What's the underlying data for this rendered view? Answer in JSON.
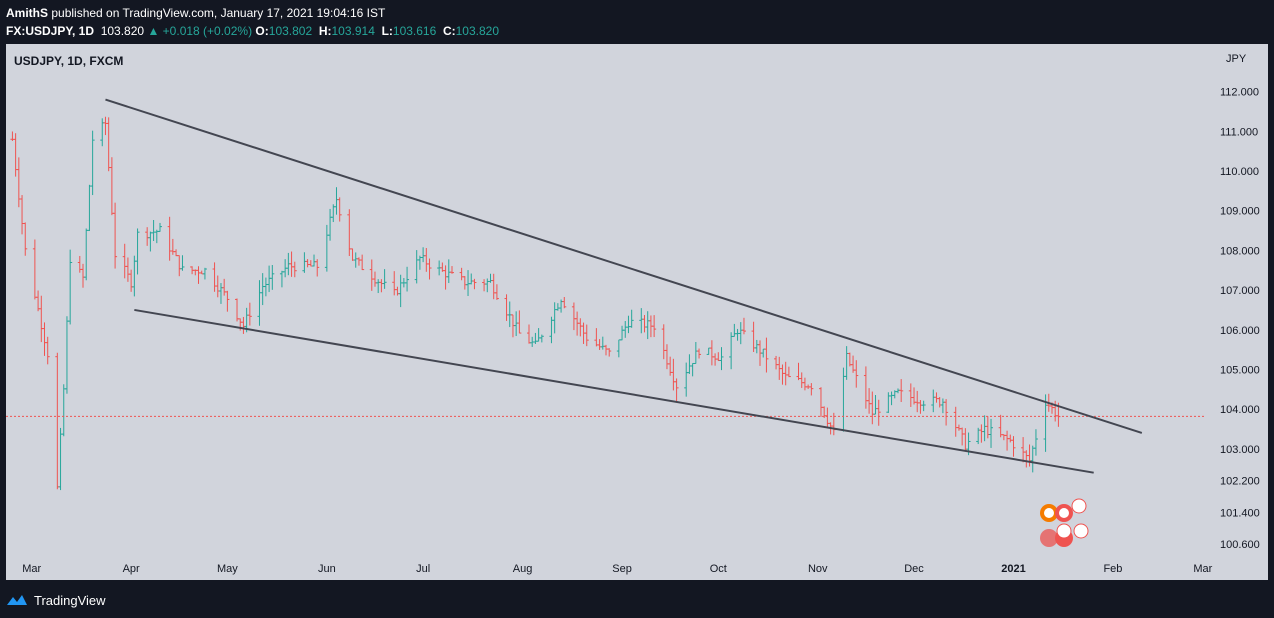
{
  "header": {
    "author": "AmithS",
    "published_text": "published on TradingView.com, January 17, 2021 19:04:16 IST",
    "symbol": "FX:USDJPY, 1D",
    "last": "103.820",
    "change_arrow": "▲",
    "change": "+0.018 (+0.02%)",
    "o_label": "O:",
    "o_value": "103.802",
    "h_label": "H:",
    "h_value": "103.914",
    "l_label": "L:",
    "l_value": "103.616",
    "c_label": "C:",
    "c_value": "103.820"
  },
  "chart_label": "USDJPY, 1D, FXCM",
  "currency": "JPY",
  "footer": {
    "brand": "TradingView"
  },
  "colors": {
    "background": "#d1d4dc",
    "up": "#26a69a",
    "down": "#ef5350",
    "trendline": "#434651",
    "price_line": "#ef5350"
  },
  "chart_data": {
    "type": "ohlc",
    "symbol": "USDJPY",
    "timeframe": "1D",
    "source": "FXCM",
    "y_ticks": [
      "112.000",
      "111.000",
      "110.000",
      "109.000",
      "108.000",
      "107.000",
      "106.000",
      "105.000",
      "104.000",
      "103.000",
      "102.200",
      "101.400",
      "100.600"
    ],
    "x_ticks": [
      "Mar",
      "Apr",
      "May",
      "Jun",
      "Jul",
      "Aug",
      "Sep",
      "Oct",
      "Nov",
      "Dec",
      "2021",
      "Feb",
      "Mar"
    ],
    "ylim": [
      100.2,
      113.2
    ],
    "last_price": 103.82,
    "close_path": [
      [
        "2020-02-24",
        110.8
      ],
      [
        "2020-02-28",
        108.0
      ],
      [
        "2020-03-06",
        105.4
      ],
      [
        "2020-03-09",
        102.0
      ],
      [
        "2020-03-11",
        104.5
      ],
      [
        "2020-03-13",
        107.8
      ],
      [
        "2020-03-17",
        107.3
      ],
      [
        "2020-03-20",
        110.8
      ],
      [
        "2020-03-24",
        111.2
      ],
      [
        "2020-03-27",
        107.9
      ],
      [
        "2020-04-01",
        107.2
      ],
      [
        "2020-04-03",
        108.4
      ],
      [
        "2020-04-10",
        108.5
      ],
      [
        "2020-04-17",
        107.5
      ],
      [
        "2020-04-24",
        107.5
      ],
      [
        "2020-05-01",
        106.8
      ],
      [
        "2020-05-06",
        106.1
      ],
      [
        "2020-05-12",
        107.1
      ],
      [
        "2020-05-20",
        107.6
      ],
      [
        "2020-05-29",
        107.6
      ],
      [
        "2020-06-04",
        109.3
      ],
      [
        "2020-06-09",
        107.8
      ],
      [
        "2020-06-16",
        107.3
      ],
      [
        "2020-06-22",
        106.9
      ],
      [
        "2020-06-30",
        107.8
      ],
      [
        "2020-07-06",
        107.5
      ],
      [
        "2020-07-14",
        107.2
      ],
      [
        "2020-07-22",
        107.2
      ],
      [
        "2020-07-31",
        105.9
      ],
      [
        "2020-08-05",
        105.6
      ],
      [
        "2020-08-13",
        106.8
      ],
      [
        "2020-08-21",
        105.8
      ],
      [
        "2020-08-28",
        105.4
      ],
      [
        "2020-09-03",
        106.2
      ],
      [
        "2020-09-11",
        106.1
      ],
      [
        "2020-09-18",
        104.6
      ],
      [
        "2020-09-25",
        105.5
      ],
      [
        "2020-10-02",
        105.3
      ],
      [
        "2020-10-07",
        106.0
      ],
      [
        "2020-10-15",
        105.4
      ],
      [
        "2020-10-22",
        104.8
      ],
      [
        "2020-10-30",
        104.6
      ],
      [
        "2020-11-06",
        103.4
      ],
      [
        "2020-11-10",
        105.3
      ],
      [
        "2020-11-18",
        103.9
      ],
      [
        "2020-11-26",
        104.4
      ],
      [
        "2020-12-04",
        104.2
      ],
      [
        "2020-12-10",
        104.2
      ],
      [
        "2020-12-17",
        103.1
      ],
      [
        "2020-12-23",
        103.5
      ],
      [
        "2020-12-31",
        103.2
      ],
      [
        "2021-01-06",
        102.7
      ],
      [
        "2021-01-11",
        104.2
      ],
      [
        "2021-01-15",
        103.82
      ]
    ],
    "trendlines": [
      {
        "name": "upper",
        "x1": "2020-03-24",
        "y1": 111.8,
        "x2": "2021-02-10",
        "y2": 103.4
      },
      {
        "name": "lower",
        "x1": "2020-04-02",
        "y1": 106.5,
        "x2": "2021-01-26",
        "y2": 102.4
      }
    ],
    "grid": false
  }
}
